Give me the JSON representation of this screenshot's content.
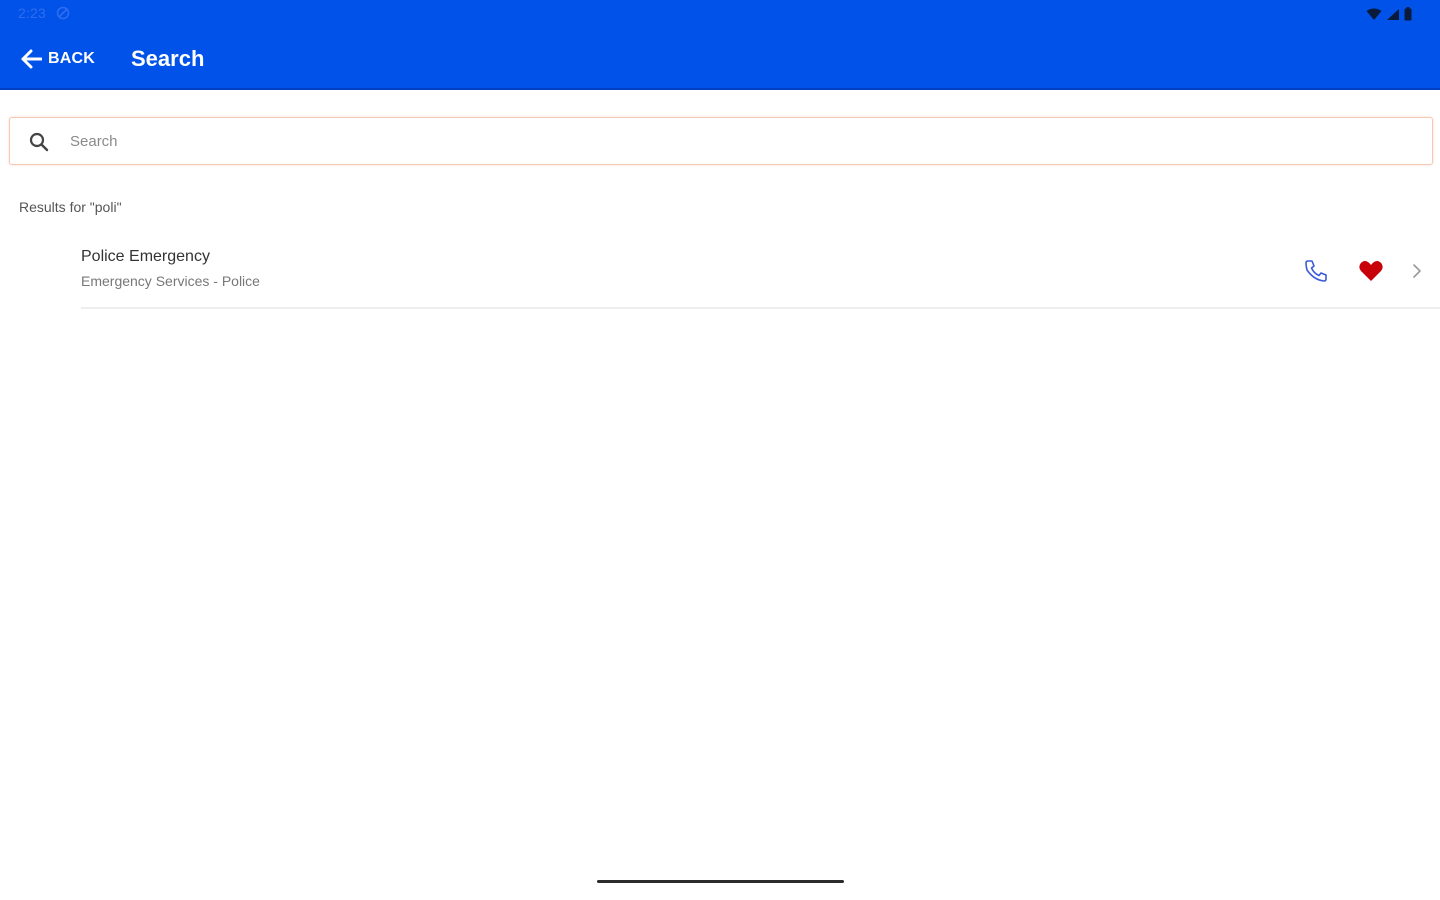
{
  "status_bar": {
    "time": "2:23"
  },
  "header": {
    "back_label": "BACK",
    "title": "Search"
  },
  "search": {
    "placeholder": "Search",
    "value": ""
  },
  "results": {
    "label": "Results for \"poli\"",
    "items": [
      {
        "title": "Police Emergency",
        "subtitle": "Emergency Services - Police",
        "favorite": true
      }
    ]
  },
  "icons": {
    "back": "arrow-left-icon",
    "search": "search-icon",
    "call": "phone-icon",
    "favorite": "heart-icon",
    "open": "chevron-right-icon"
  },
  "colors": {
    "app_bar": "#0052e8",
    "search_border": "#f6c8b6",
    "phone": "#3d5bd9",
    "heart": "#c8000a",
    "chevron": "#9a9a9a"
  }
}
